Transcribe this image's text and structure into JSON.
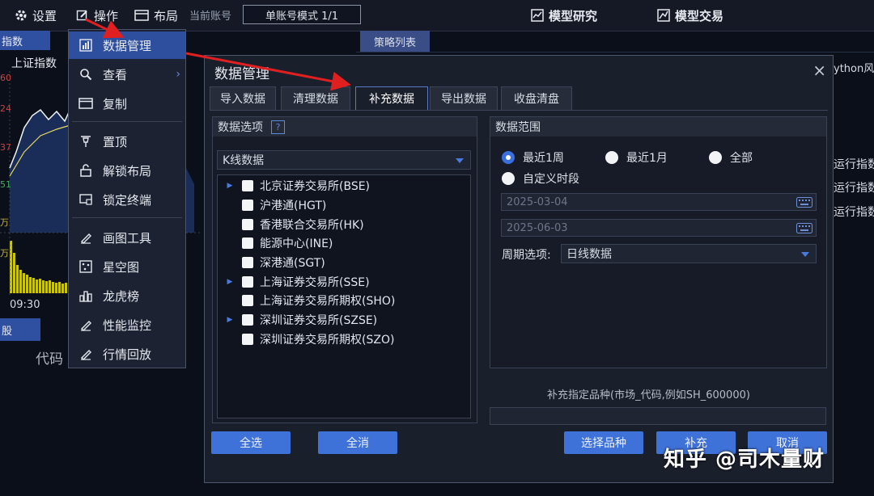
{
  "toolbar": {
    "settings": "设置",
    "operation": "操作",
    "layout": "布局",
    "account_label": "当前账号",
    "account_mode": "单账号模式 1/1",
    "model_research": "模型研究",
    "model_trading": "模型交易"
  },
  "left_panel": {
    "tab": "指数",
    "index_title": "上证指数",
    "y_labels": [
      "60",
      "24",
      "37",
      "51"
    ],
    "volume_labels": [
      "万",
      "万"
    ],
    "time": "09:30",
    "stock_tab": "股",
    "code_header": "代码"
  },
  "right_panel": {
    "strategy_tab": "策略列表",
    "python_label": "ython风",
    "rows": [
      "运行指数",
      "运行指数",
      "运行指数"
    ]
  },
  "menu": {
    "items": [
      {
        "label": "数据管理",
        "icon": "bar-chart-icon",
        "active": true
      },
      {
        "label": "查看",
        "icon": "magnifier-icon",
        "submenu": true
      },
      {
        "label": "复制",
        "icon": "window-copy-icon"
      },
      {
        "label": "置顶",
        "icon": "pin-icon"
      },
      {
        "label": "解锁布局",
        "icon": "unlock-icon"
      },
      {
        "label": "锁定终端",
        "icon": "lock-terminal-icon"
      },
      {
        "label": "画图工具",
        "icon": "pencil-icon"
      },
      {
        "label": "星空图",
        "icon": "star-map-icon"
      },
      {
        "label": "龙虎榜",
        "icon": "dragon-tiger-icon"
      },
      {
        "label": "性能监控",
        "icon": "pencil-monitor-icon"
      },
      {
        "label": "行情回放",
        "icon": "pencil-replay-icon"
      }
    ]
  },
  "dialog": {
    "title": "数据管理",
    "close": "×",
    "tabs": [
      "导入数据",
      "清理数据",
      "补充数据",
      "导出数据",
      "收盘清盘"
    ],
    "active_tab": "补充数据",
    "data_options": {
      "header": "数据选项",
      "help": "?",
      "kline_type": "K线数据",
      "markets": [
        {
          "label": "北京证券交易所(BSE)",
          "expandable": true
        },
        {
          "label": "沪港通(HGT)",
          "expandable": false
        },
        {
          "label": "香港联合交易所(HK)",
          "expandable": false
        },
        {
          "label": "能源中心(INE)",
          "expandable": false
        },
        {
          "label": "深港通(SGT)",
          "expandable": false
        },
        {
          "label": "上海证券交易所(SSE)",
          "expandable": true
        },
        {
          "label": "上海证券交易所期权(SHO)",
          "expandable": false
        },
        {
          "label": "深圳证券交易所(SZSE)",
          "expandable": true
        },
        {
          "label": "深圳证券交易所期权(SZO)",
          "expandable": false
        }
      ]
    },
    "data_range": {
      "header": "数据范围",
      "radio_week": "最近1周",
      "radio_month": "最近1月",
      "radio_all": "全部",
      "radio_custom": "自定义时段",
      "selected": "最近1周",
      "start_date": "2025-03-04",
      "end_date": "2025-06-03",
      "period_label": "周期选项:",
      "period_value": "日线数据"
    },
    "hint": "补充指定品种(市场_代码,例如SH_600000)",
    "buttons": {
      "select_all": "全选",
      "clear_all": "全消",
      "select_variety": "选择品种",
      "supplement": "补充",
      "cancel": "取消"
    }
  },
  "watermark": "知乎 @司木量财",
  "colors": {
    "accent_blue": "#3f72d8",
    "active_menu": "#2e4f9e",
    "annotation_arrow": "#e02020"
  }
}
